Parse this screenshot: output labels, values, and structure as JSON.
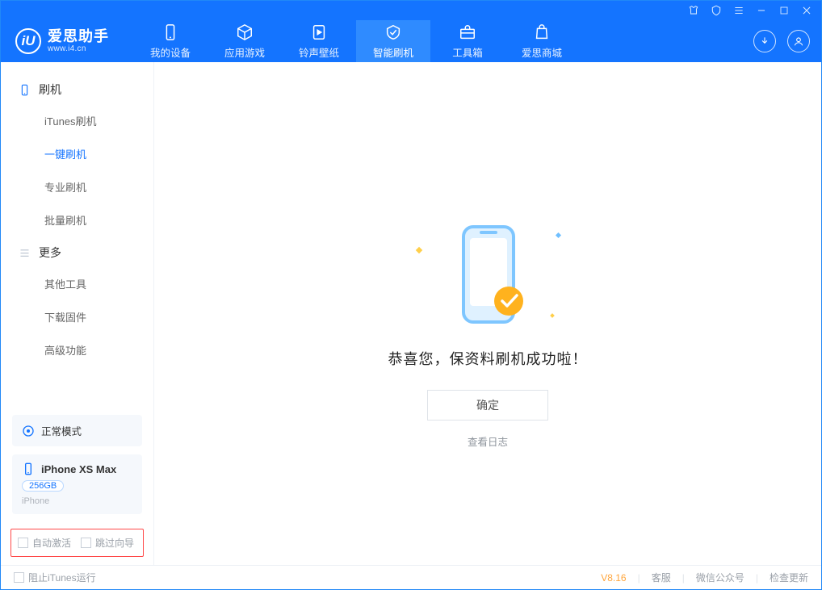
{
  "colors": {
    "brand_blue": "#1474ff",
    "accent_orange": "#ffa63d",
    "alert_red": "#ff4848",
    "muted": "#9aa0a8"
  },
  "window_icons": [
    "tshirt",
    "cube",
    "menu",
    "minimize",
    "maximize",
    "close"
  ],
  "app": {
    "name": "爱思助手",
    "url_label": "www.i4.cn",
    "logo_letter": "iU"
  },
  "nav": [
    {
      "id": "my-device",
      "label": "我的设备",
      "icon": "phone"
    },
    {
      "id": "apps-games",
      "label": "应用游戏",
      "icon": "cube"
    },
    {
      "id": "ring-wall",
      "label": "铃声壁纸",
      "icon": "music"
    },
    {
      "id": "smart-flash",
      "label": "智能刷机",
      "icon": "shield",
      "active": true
    },
    {
      "id": "toolbox",
      "label": "工具箱",
      "icon": "briefcase"
    },
    {
      "id": "shop",
      "label": "爱思商城",
      "icon": "bag"
    }
  ],
  "header_buttons": {
    "download": "download-icon",
    "user": "user-icon"
  },
  "sidebar": {
    "group_flash": {
      "title": "刷机",
      "items": [
        {
          "id": "itunes",
          "label": "iTunes刷机"
        },
        {
          "id": "oneclick",
          "label": "一键刷机",
          "active": true
        },
        {
          "id": "pro",
          "label": "专业刷机"
        },
        {
          "id": "batch",
          "label": "批量刷机"
        }
      ]
    },
    "group_more": {
      "title": "更多",
      "items": [
        {
          "id": "other",
          "label": "其他工具"
        },
        {
          "id": "firmware",
          "label": "下载固件"
        },
        {
          "id": "advanced",
          "label": "高级功能"
        }
      ]
    }
  },
  "mode_card": {
    "label": "正常模式",
    "icon": "status-normal-icon"
  },
  "device_card": {
    "name": "iPhone XS Max",
    "capacity": "256GB",
    "platform": "iPhone",
    "icon": "device-icon"
  },
  "options": {
    "auto_activate": "自动激活",
    "skip_wizard": "跳过向导"
  },
  "content": {
    "success_msg": "恭喜您，保资料刷机成功啦！",
    "ok_btn": "确定",
    "view_log": "查看日志"
  },
  "status": {
    "block_itunes": "阻止iTunes运行",
    "version": "V8.16",
    "links": [
      "客服",
      "微信公众号",
      "检查更新"
    ]
  }
}
